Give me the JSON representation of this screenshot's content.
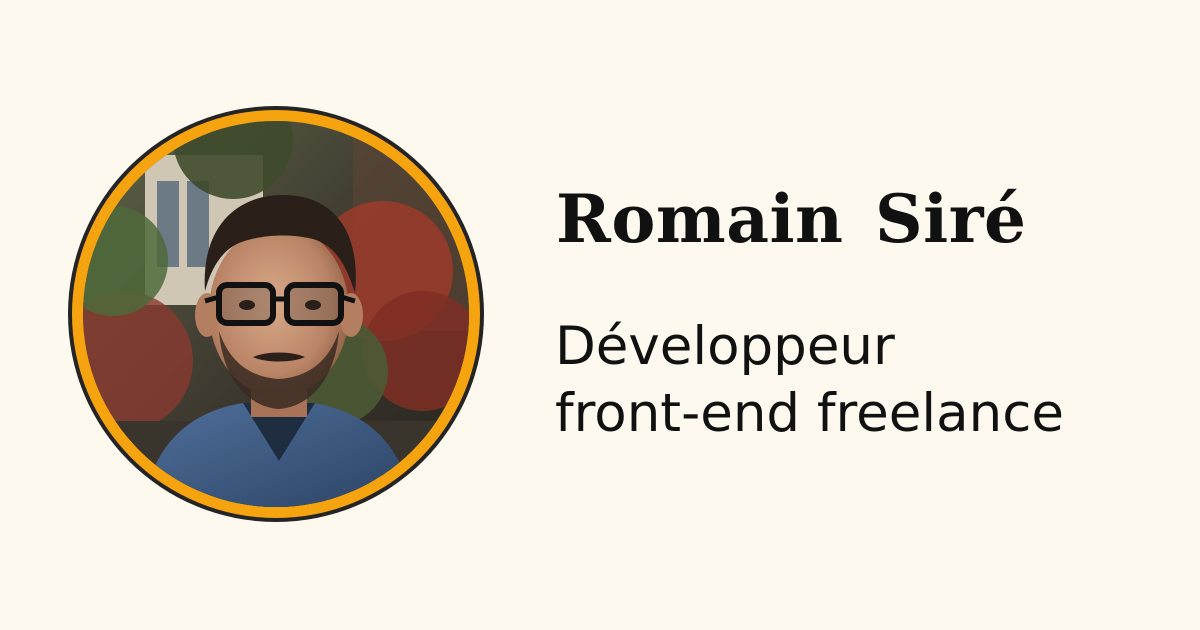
{
  "profile": {
    "name": "Romain Siré",
    "tagline_line1": "Développeur",
    "tagline_line2": "front-end freelance"
  },
  "colors": {
    "background": "#fdf9ee",
    "ring": "#f5a30e",
    "ring_outline": "#242424",
    "text": "#111111"
  }
}
